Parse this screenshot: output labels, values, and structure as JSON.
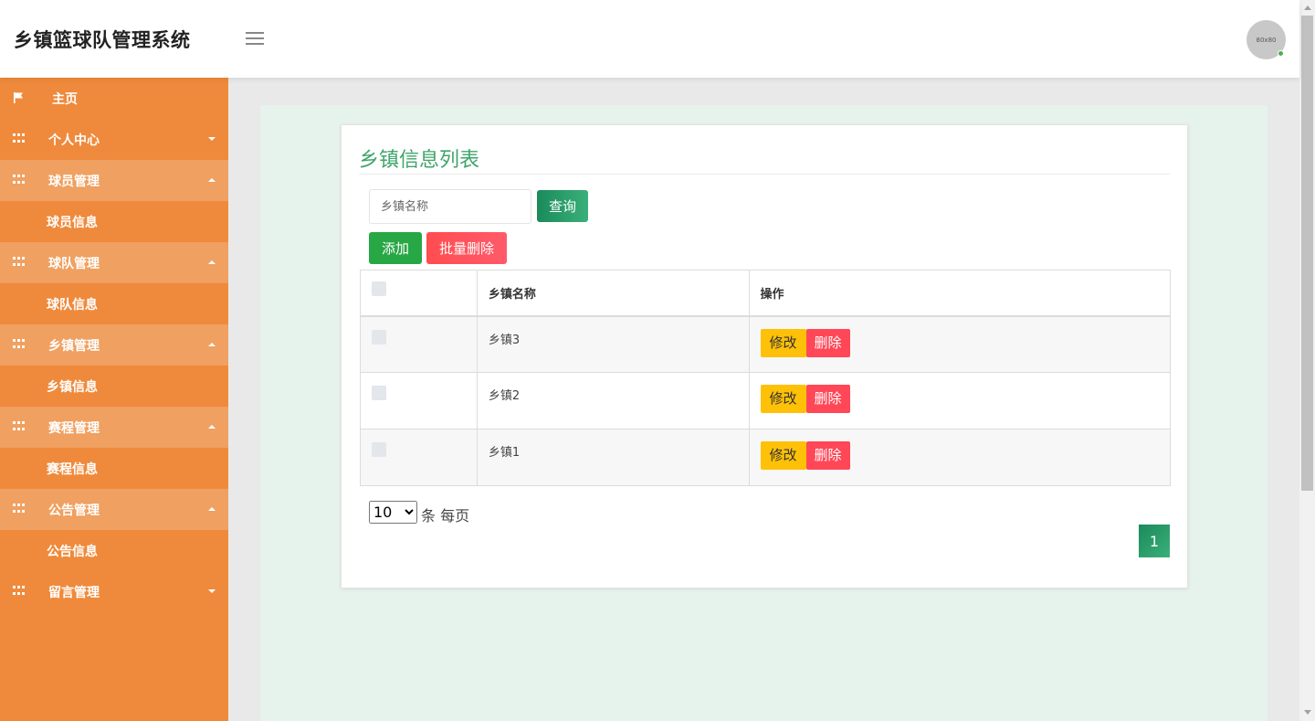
{
  "header": {
    "title": "乡镇篮球队管理系统",
    "avatar_text": "80x80"
  },
  "sidebar": {
    "items": [
      {
        "label": "主页",
        "icon": "flag-icon",
        "type": "home"
      },
      {
        "label": "个人中心",
        "icon": "grid-icon",
        "caret": "down"
      },
      {
        "label": "球员管理",
        "icon": "grid-icon",
        "caret": "up",
        "open": true
      },
      {
        "label": "球员信息",
        "sub": true
      },
      {
        "label": "球队管理",
        "icon": "grid-icon",
        "caret": "up",
        "open": true
      },
      {
        "label": "球队信息",
        "sub": true
      },
      {
        "label": "乡镇管理",
        "icon": "grid-icon",
        "caret": "up",
        "open": true
      },
      {
        "label": "乡镇信息",
        "sub": true
      },
      {
        "label": "赛程管理",
        "icon": "grid-icon",
        "caret": "up",
        "open": true
      },
      {
        "label": "赛程信息",
        "sub": true
      },
      {
        "label": "公告管理",
        "icon": "grid-icon",
        "caret": "up",
        "open": true
      },
      {
        "label": "公告信息",
        "sub": true
      },
      {
        "label": "留言管理",
        "icon": "grid-icon",
        "caret": "down"
      }
    ]
  },
  "main": {
    "title": "乡镇信息列表",
    "search": {
      "placeholder": "乡镇名称",
      "value": ""
    },
    "query_label": "查询",
    "add_label": "添加",
    "batch_delete_label": "批量删除",
    "table": {
      "headers": [
        "",
        "乡镇名称",
        "操作"
      ],
      "rows": [
        {
          "name": "乡镇3"
        },
        {
          "name": "乡镇2"
        },
        {
          "name": "乡镇1"
        }
      ],
      "edit_label": "修改",
      "delete_label": "删除"
    },
    "pagination": {
      "page_size": "10",
      "page_size_options": [
        "10"
      ],
      "per_page_label": "条 每页",
      "current_page": "1"
    }
  },
  "colors": {
    "sidebar": "#ef8a3c",
    "accent_green": "#3fa56a",
    "edit_yellow": "#ffc107",
    "delete_red": "#ff4757"
  }
}
